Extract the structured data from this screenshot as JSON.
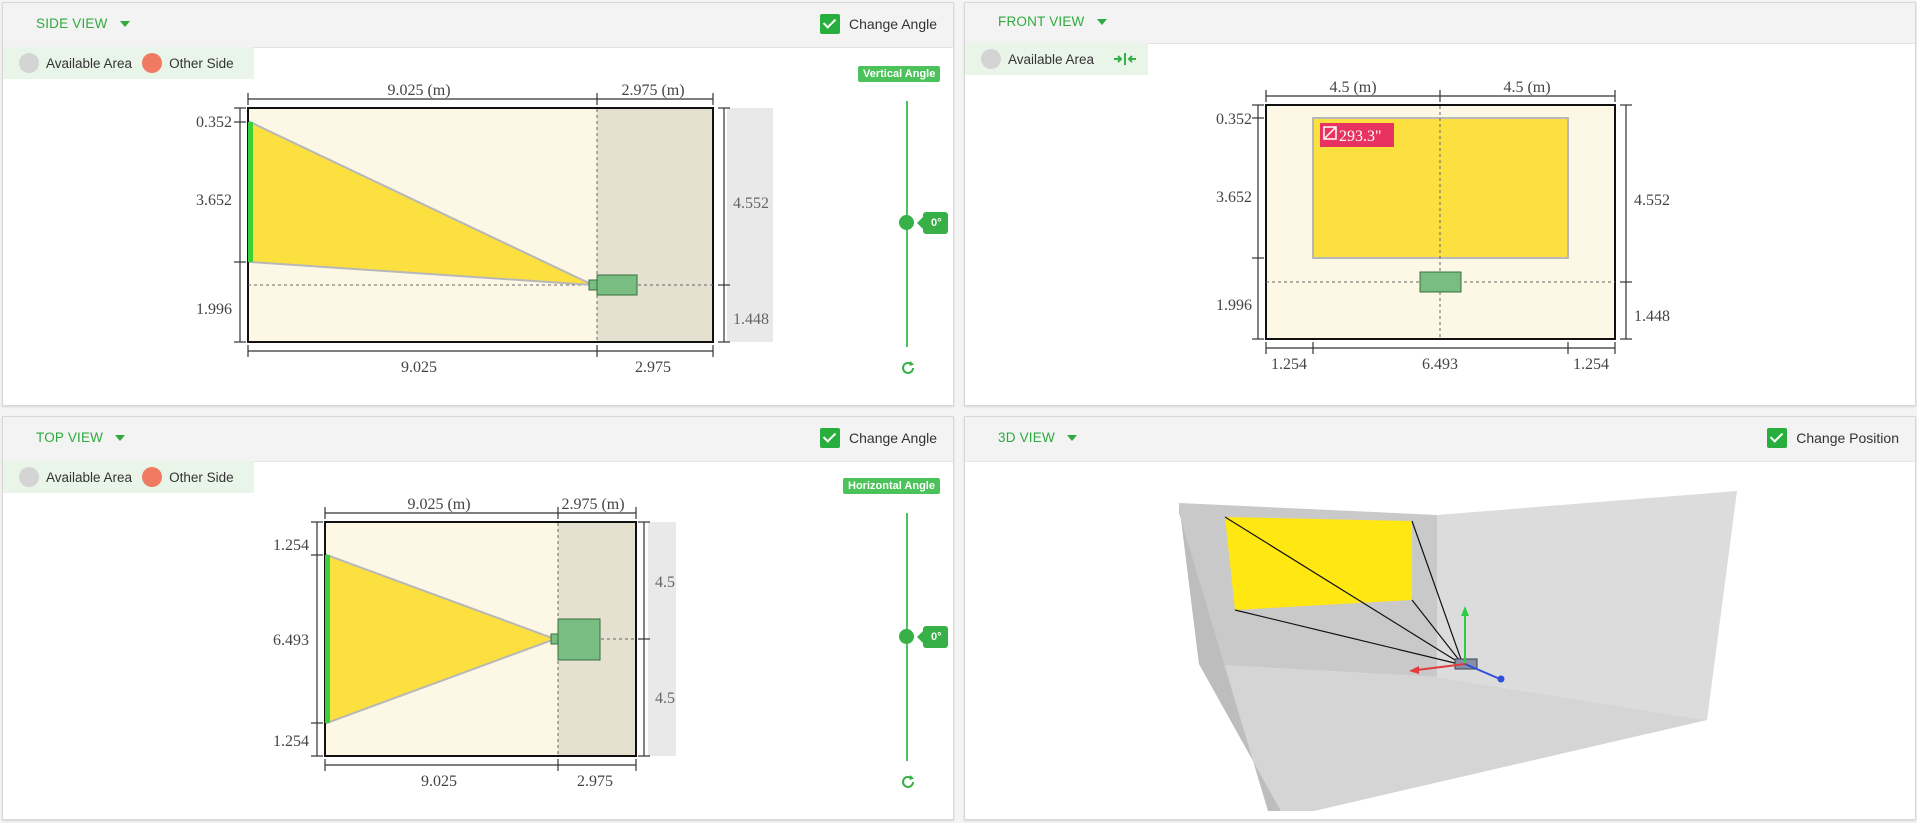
{
  "colors": {
    "accent": "#2eaa3e",
    "screen": "#fbe03f",
    "room": "#fdf8e6",
    "other_side": "#e4e1d1",
    "projector": "#79bd82",
    "other_side_dot": "#f07a62",
    "available_dot": "#d4d4d4",
    "badge": "#e8325f"
  },
  "side_view": {
    "title": "SIDE VIEW",
    "change_angle_label": "Change Angle",
    "legend": {
      "available": "Available Area",
      "other": "Other Side"
    },
    "angle_badge": "Vertical Angle",
    "slider_value": "0°",
    "dims": {
      "top_left": "9.025 (m)",
      "top_right": "2.975 (m)",
      "left_1": "0.352",
      "left_2": "3.652",
      "left_3": "1.996",
      "right_1": "4.552",
      "right_2": "1.448",
      "bottom_left": "9.025",
      "bottom_right": "2.975"
    }
  },
  "front_view": {
    "title": "FRONT VIEW",
    "legend": {
      "available": "Available Area"
    },
    "shrink_icon": "compress-horizontal-icon",
    "diagonal_badge": "293.3\"",
    "dims": {
      "top_left": "4.5 (m)",
      "top_right": "4.5 (m)",
      "left_1": "0.352",
      "left_2": "3.652",
      "left_3": "1.996",
      "right_1": "4.552",
      "right_2": "1.448",
      "bottom_1": "1.254",
      "bottom_2": "6.493",
      "bottom_3": "1.254"
    }
  },
  "top_view": {
    "title": "TOP VIEW",
    "change_angle_label": "Change Angle",
    "legend": {
      "available": "Available Area",
      "other": "Other Side"
    },
    "angle_badge": "Horizontal Angle",
    "slider_value": "0°",
    "dims": {
      "top_left": "9.025 (m)",
      "top_right": "2.975 (m)",
      "left_1": "1.254",
      "left_2": "6.493",
      "left_3": "1.254",
      "right_1": "4.5",
      "right_2": "4.5",
      "bottom_left": "9.025",
      "bottom_right": "2.975"
    }
  },
  "view_3d": {
    "title": "3D VIEW",
    "change_position_label": "Change Position"
  }
}
